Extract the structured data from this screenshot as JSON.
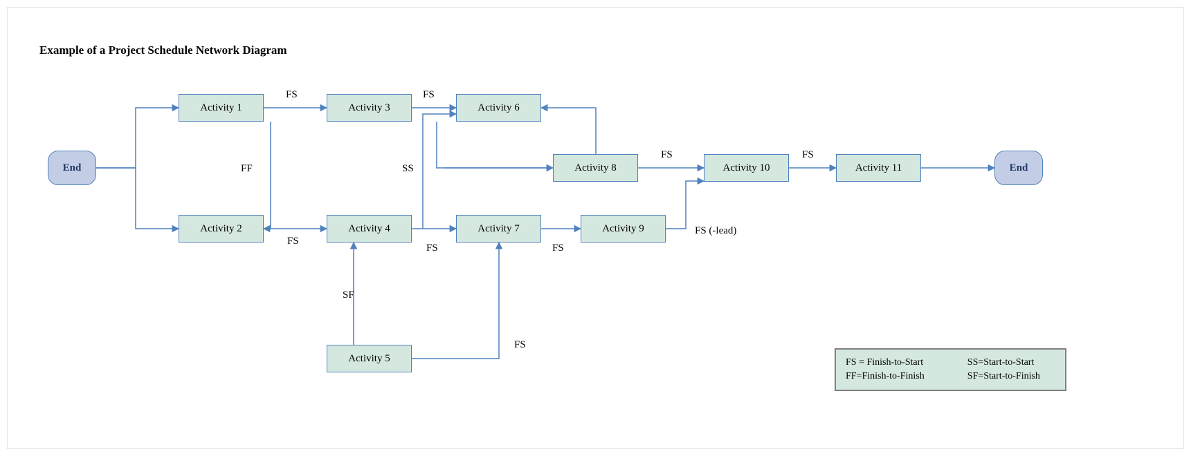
{
  "title": "Example of a Project Schedule Network Diagram",
  "nodes": {
    "start": "End",
    "a1": "Activity 1",
    "a2": "Activity 2",
    "a3": "Activity 3",
    "a4": "Activity 4",
    "a5": "Activity 5",
    "a6": "Activity 6",
    "a7": "Activity 7",
    "a8": "Activity 8",
    "a9": "Activity 9",
    "a10": "Activity 10",
    "a11": "Activity 11",
    "end": "End"
  },
  "edgeLabels": {
    "e1": "FS",
    "e2": "FS",
    "e3": "FF",
    "e4": "SS",
    "e5": "FS",
    "e6": "FS",
    "e7": "SF",
    "e8": "FS",
    "e9": "FS",
    "e10": "FS",
    "e11": "FS (-lead)",
    "e12": "FS"
  },
  "legend": {
    "fs": "FS = Finish-to-Start",
    "ss": "SS=Start-to-Start",
    "ff": "FF=Finish-to-Finish",
    "sf": "SF=Start-to-Finish"
  }
}
